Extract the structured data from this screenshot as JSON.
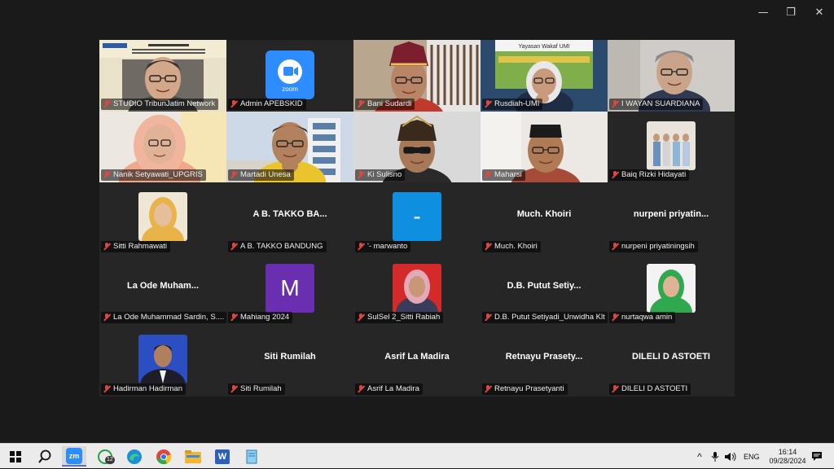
{
  "window": {
    "controls": {
      "minimize": "—",
      "restore": "❐",
      "close": "✕"
    }
  },
  "participants": [
    {
      "name": "STUDIO TribunJatim Network",
      "kind": "video",
      "scene": "studio"
    },
    {
      "name": "Admin APEBSKID",
      "kind": "video",
      "scene": "zoom-logo",
      "logo_text": "zoom"
    },
    {
      "name": "Bani Sudardi",
      "kind": "video",
      "scene": "man-hat"
    },
    {
      "name": "Rusdiah-UMI",
      "kind": "video",
      "scene": "banner",
      "banner_text": "Yayasan Wakaf UMI"
    },
    {
      "name": "I WAYAN SUARDIANA",
      "kind": "video",
      "scene": "man-grey",
      "active": true
    },
    {
      "name": "Nanik Setyawati_UPGRIS",
      "kind": "video",
      "scene": "woman-hijab"
    },
    {
      "name": "Martadi Unesa",
      "kind": "video",
      "scene": "man-building"
    },
    {
      "name": "Ki Sulisno",
      "kind": "video",
      "scene": "man-blangkon"
    },
    {
      "name": "Maharsi",
      "kind": "video",
      "scene": "man-peci"
    },
    {
      "name": "Baiq Rizki Hidayati",
      "kind": "photo",
      "photo": "group"
    },
    {
      "name": "Sitti Rahmawati",
      "kind": "photo",
      "photo": "hijab-yellow"
    },
    {
      "name": "A B. TAKKO BANDUNG",
      "kind": "text",
      "display": "A B. TAKKO BA..."
    },
    {
      "name": "'- marwanto",
      "kind": "letter",
      "letter": "-",
      "color": "#0e8fe0"
    },
    {
      "name": "Much. Khoiri",
      "kind": "text",
      "display": "Much. Khoiri"
    },
    {
      "name": "nurpeni priyatiningsih",
      "kind": "text",
      "display": "nurpeni  priyatin..."
    },
    {
      "name": "La Ode Muhammad Sardin, S....",
      "kind": "text",
      "display": "La Ode Muham..."
    },
    {
      "name": "Mahiang 2024",
      "kind": "letter",
      "letter": "M",
      "color": "#6a2fb0"
    },
    {
      "name": "SulSel 2_Sitti Rabiah",
      "kind": "photo",
      "photo": "hijab-red"
    },
    {
      "name": "D.B. Putut Setiyadi_Unwidha Klt",
      "kind": "text",
      "display": "D.B.  Putut  Setiy..."
    },
    {
      "name": "nurtaqwa amin",
      "kind": "photo",
      "photo": "hijab-green"
    },
    {
      "name": "Hadirman Hadirman",
      "kind": "photo",
      "photo": "man-suit"
    },
    {
      "name": "Siti Rumilah",
      "kind": "text",
      "display": "Siti Rumilah"
    },
    {
      "name": "Asrif La Madira",
      "kind": "text",
      "display": "Asrif La Madira"
    },
    {
      "name": "Retnayu Prasetyanti",
      "kind": "text",
      "display": "Retnayu  Prasety..."
    },
    {
      "name": "DILELI D ASTOETI",
      "kind": "text",
      "display": "DILELI D ASTOETI"
    }
  ],
  "taskbar": {
    "apps": [
      {
        "name": "start",
        "icon": "windows-icon"
      },
      {
        "name": "search",
        "icon": "search-icon"
      },
      {
        "name": "zoom",
        "icon": "zoom-icon",
        "label": "zm",
        "active": true
      },
      {
        "name": "whatsapp",
        "icon": "whatsapp-icon",
        "badge": "12"
      },
      {
        "name": "edge",
        "icon": "edge-icon"
      },
      {
        "name": "chrome",
        "icon": "chrome-icon"
      },
      {
        "name": "file-explorer",
        "icon": "folder-icon"
      },
      {
        "name": "word",
        "icon": "word-icon",
        "label": "W"
      },
      {
        "name": "notepad",
        "icon": "notepad-icon"
      }
    ],
    "tray": {
      "chevron": "^",
      "language": "ENG",
      "time": "16:14",
      "date": "09/28/2024"
    }
  },
  "colors": {
    "active_speaker": "#5cc36e",
    "muted_mic": "#e0463f",
    "tile_bg": "#262626",
    "taskbar_bg": "#ebebeb"
  }
}
